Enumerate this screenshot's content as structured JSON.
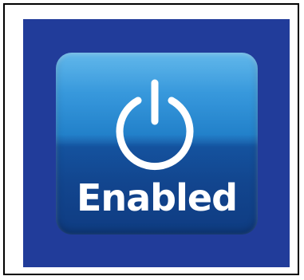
{
  "status_tile": {
    "icon": "power-icon",
    "label": "Enabled",
    "state": "on"
  },
  "colors": {
    "background_panel": "#213c9a",
    "tile_top": "#3fa8e6",
    "tile_bottom": "#0f3c82",
    "icon_and_text": "#ffffff",
    "frame_border": "#000000"
  }
}
